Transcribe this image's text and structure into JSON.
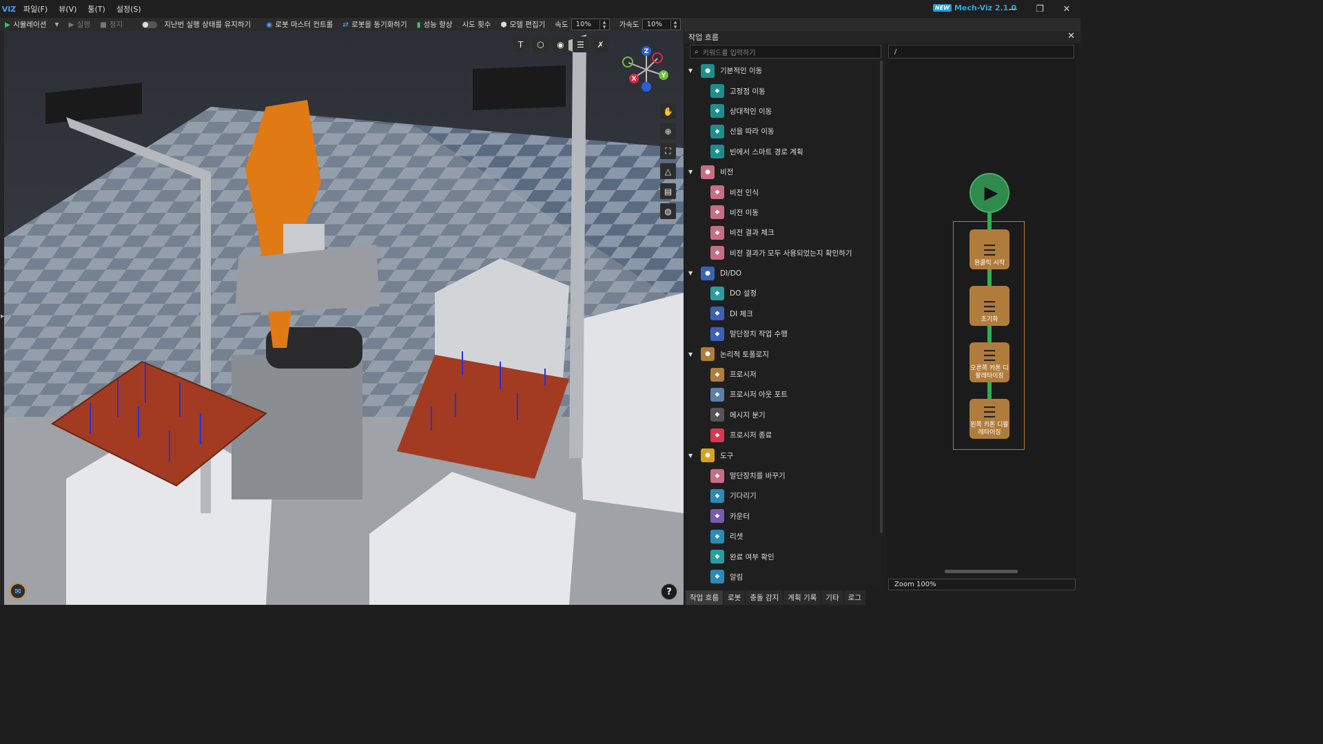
{
  "app": {
    "logo": "VIZ",
    "badge": "NEW",
    "name": "Mech-Viz 2.1.0"
  },
  "menu": [
    "파일(F)",
    "뷰(V)",
    "툴(T)",
    "설정(S)"
  ],
  "window_controls": [
    "—",
    "❐",
    "✕"
  ],
  "toolbar": {
    "simulation": "시뮬레이션",
    "run": "실행",
    "stop": "정지",
    "keep_state": "지난번 실행 상태를 유지하기",
    "master_control": "로봇 마스터 컨트롤",
    "sync_robot": "로봇을 동기화하기",
    "performance": "성능 향상",
    "retries": "시도 횟수",
    "model_editor": "모델 편집기",
    "speed_label": "속도",
    "speed_value": "10%",
    "accel_label": "가속도",
    "accel_value": "10%"
  },
  "panel": {
    "title": "작업 흐름",
    "close": "✕"
  },
  "library": {
    "search_placeholder": "키워드를 입력하기",
    "categories": [
      {
        "label": "기본적인 이동",
        "color": "#1b8f8f",
        "items": [
          {
            "label": "고정점 이동",
            "color": "#1b8f8f",
            "icon": "pin-icon"
          },
          {
            "label": "상대적인 이동",
            "color": "#1b8f8f",
            "icon": "pins-icon"
          },
          {
            "label": "선을 따라 이동",
            "color": "#1b8f8f",
            "icon": "line-icon"
          },
          {
            "label": "빈에서 스마트 경로 계획",
            "color": "#1b8f8f",
            "icon": "bin-icon"
          }
        ]
      },
      {
        "label": "비전",
        "color": "#c96d84",
        "items": [
          {
            "label": "비전 인식",
            "color": "#c96d84",
            "icon": "camera-icon"
          },
          {
            "label": "비전 이동",
            "color": "#c96d84",
            "icon": "camera-move-icon"
          },
          {
            "label": "비전 결과 체크",
            "color": "#c96d84",
            "icon": "camera-check-icon"
          },
          {
            "label": "비전 결과가 모두 사용되었는지 확인하기",
            "color": "#c96d84",
            "icon": "camera-all-icon"
          }
        ]
      },
      {
        "label": "DI/DO",
        "color": "#3b62b8",
        "items": [
          {
            "label": "DO 설정",
            "color": "#2a9da0",
            "icon": "do-icon"
          },
          {
            "label": "DI 체크",
            "color": "#3b62b8",
            "icon": "di-icon"
          },
          {
            "label": "말단장치 작업 수행",
            "color": "#3b62b8",
            "icon": "gripper-icon"
          }
        ]
      },
      {
        "label": "논리적 토폴로지",
        "color": "#b07c3c",
        "items": [
          {
            "label": "프로시저",
            "color": "#b07c3c",
            "icon": "procedure-icon"
          },
          {
            "label": "프로시저 아웃 포트",
            "color": "#5a7fa8",
            "icon": "outport-icon"
          },
          {
            "label": "메시지 분기",
            "color": "#555",
            "icon": "branch-icon"
          },
          {
            "label": "프로시저 종료",
            "color": "#d8384b",
            "icon": "end-icon"
          }
        ]
      },
      {
        "label": "도구",
        "color": "#d6a21e",
        "items": [
          {
            "label": "말단장치를 바꾸기",
            "color": "#c96d84",
            "icon": "swap-tool-icon"
          },
          {
            "label": "기다리기",
            "color": "#2a8ab8",
            "icon": "wait-icon"
          },
          {
            "label": "카운터",
            "color": "#7a5ab0",
            "icon": "counter-icon"
          },
          {
            "label": "리셋",
            "color": "#2a8ab8",
            "icon": "reset-icon"
          },
          {
            "label": "완료 여부 확인",
            "color": "#2a9da0",
            "icon": "check-done-icon"
          },
          {
            "label": "알림",
            "color": "#2a8ab8",
            "icon": "notify-icon"
          }
        ]
      }
    ]
  },
  "graph": {
    "path": "/",
    "steps": [
      "원클릭 시작",
      "초기화",
      "오른쪽 카톤 디팔레타이징",
      "왼쪽 카톤 디팔레타이징"
    ],
    "zoom": "Zoom 100%"
  },
  "bottom_tabs": [
    "작업 흐름",
    "로봇",
    "충돌 감지",
    "계획 기록",
    "기타",
    "로그"
  ],
  "axes": {
    "z": "Z",
    "y": "Y",
    "x": "X"
  }
}
